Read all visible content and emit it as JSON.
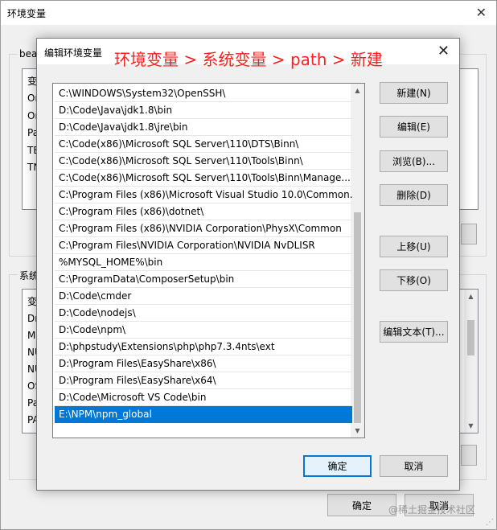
{
  "parent_window": {
    "title": "环境变量",
    "close_glyph": "✕",
    "user_group_label": "bea",
    "user_list_header": "变",
    "user_list_items": [
      "On",
      "On",
      "Pa",
      "TE",
      "TN"
    ],
    "system_group_label": "系统",
    "system_list_header": "变",
    "system_list_items": [
      "Dr",
      "M",
      "NU",
      "NU",
      "OS",
      "Pa",
      "PA"
    ],
    "ok_label": "确定",
    "cancel_label": "取消",
    "watermark": "@稀土掘金技术社区"
  },
  "dialog": {
    "title": "编辑环境变量",
    "annotation": "环境变量 > 系统变量 > path > 新建",
    "close_glyph": "✕",
    "path_entries": [
      "C:\\WINDOWS\\System32\\OpenSSH\\",
      "D:\\Code\\Java\\jdk1.8\\bin",
      "D:\\Code\\Java\\jdk1.8\\jre\\bin",
      "C:\\Code(x86)\\Microsoft SQL Server\\110\\DTS\\Binn\\",
      "C:\\Code(x86)\\Microsoft SQL Server\\110\\Tools\\Binn\\",
      "C:\\Code(x86)\\Microsoft SQL Server\\110\\Tools\\Binn\\Manage...",
      "C:\\Program Files (x86)\\Microsoft Visual Studio 10.0\\Common...",
      "C:\\Program Files (x86)\\dotnet\\",
      "C:\\Program Files (x86)\\NVIDIA Corporation\\PhysX\\Common",
      "C:\\Program Files\\NVIDIA Corporation\\NVIDIA NvDLISR",
      "%MYSQL_HOME%\\bin",
      "C:\\ProgramData\\ComposerSetup\\bin",
      "D:\\Code\\cmder",
      "D:\\Code\\nodejs\\",
      "D:\\Code\\npm\\",
      "D:\\phpstudy\\Extensions\\php\\php7.3.4nts\\ext",
      "D:\\Program Files\\EasyShare\\x86\\",
      "D:\\Program Files\\EasyShare\\x64\\",
      "D:\\Code\\Microsoft VS Code\\bin",
      "E:\\NPM\\npm_global"
    ],
    "selected_index": 19,
    "buttons": {
      "new": "新建(N)",
      "edit": "编辑(E)",
      "browse": "浏览(B)...",
      "delete": "删除(D)",
      "move_up": "上移(U)",
      "move_down": "下移(O)",
      "edit_text": "编辑文本(T)..."
    },
    "ok_label": "确定",
    "cancel_label": "取消"
  },
  "colors": {
    "selection": "#0078d7",
    "annotation": "#ff1d1d"
  }
}
